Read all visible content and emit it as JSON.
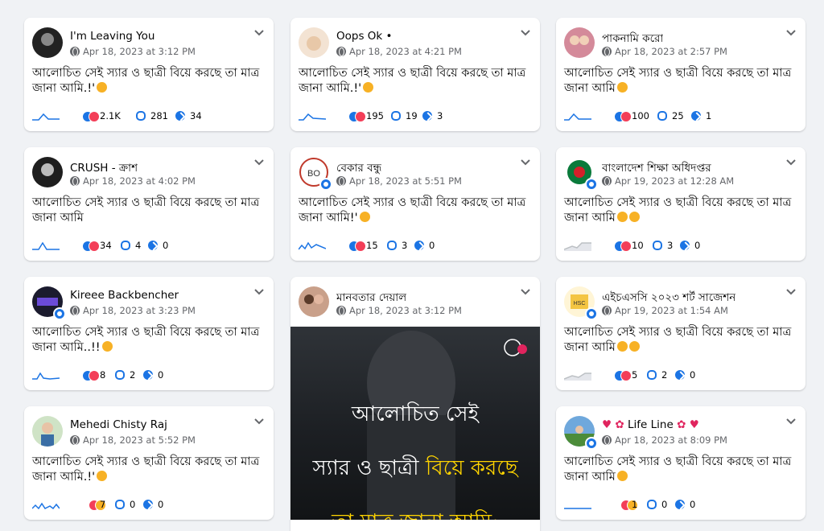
{
  "colors": {
    "accent": "#1b74e4",
    "love": "#f33e58",
    "haha": "#f7b125",
    "page_bg": "#f0f2f5"
  },
  "icons": {
    "menu": "chevron-down-icon",
    "privacy": "globe-icon",
    "comments": "comment-icon",
    "shares": "share-icon",
    "trend": "sparkline-icon"
  },
  "cards": [
    {
      "name": "I'm Leaving You",
      "date": "Apr 18, 2023 at 3:12 PM",
      "text": "আলোচিত সেই স্যার ও ছাত্রী বিয়ে করছে তা মাত্র জানা আমি.!'",
      "reactions": "2.1K",
      "comments": "281",
      "shares": "34"
    },
    {
      "name": "Oops Ok •",
      "date": "Apr 18, 2023 at 4:21 PM",
      "text": "আলোচিত সেই স্যার ও ছাত্রী বিয়ে করছে তা মাত্র জানা আমি.!'",
      "reactions": "195",
      "comments": "19",
      "shares": "3"
    },
    {
      "name": "পাকনামি করো",
      "date": "Apr 18, 2023 at 2:57 PM",
      "text": "আলোচিত সেই স্যার ও ছাত্রী বিয়ে করছে তা মাত্র জানা আমি",
      "reactions": "100",
      "comments": "25",
      "shares": "1"
    },
    {
      "name": "CRUSH - ক্রাশ",
      "date": "Apr 18, 2023 at 4:02 PM",
      "text": "আলোচিত সেই স্যার ও ছাত্রী বিয়ে করছে তা মাত্র জানা আমি",
      "reactions": "34",
      "comments": "4",
      "shares": "0"
    },
    {
      "name": "বেকার বন্ধু",
      "date": "Apr 18, 2023 at 5:51 PM",
      "text": "আলোচিত সেই স্যার ও ছাত্রী বিয়ে করছে তা মাত্র জানা আমি!'",
      "reactions": "15",
      "comments": "3",
      "shares": "0"
    },
    {
      "name": "বাংলাদেশ শিক্ষা অধিদপ্তর",
      "date": "Apr 19, 2023 at 12:28 AM",
      "text": "আলোচিত সেই স্যার ও ছাত্রী বিয়ে করছে তা মাত্র জানা আমি",
      "reactions": "10",
      "comments": "3",
      "shares": "0"
    },
    {
      "name": "Kireee Backbencher",
      "date": "Apr 18, 2023 at 3:23 PM",
      "text": "আলোচিত সেই স্যার ও ছাত্রী বিয়ে করছে তা মাত্র জানা আমি..!!",
      "reactions": "8",
      "comments": "2",
      "shares": "0"
    },
    {
      "name": "মানবতার দেয়াল",
      "date": "Apr 18, 2023 at 3:12 PM",
      "image_line1": "আলোচিত সেই",
      "image_line2a": "স্যার ও ছাত্রী ",
      "image_line2b": "বিয়ে করছে",
      "image_line3": "তা মাত্র জানা আমি:"
    },
    {
      "name": "এইচএসসি ২০২৩ শর্ট সাজেশন",
      "date": "Apr 19, 2023 at 1:54 AM",
      "text": "আলোচিত সেই স্যার ও ছাত্রী বিয়ে করছে তা মাত্র জানা আমি",
      "reactions": "5",
      "comments": "2",
      "shares": "0"
    },
    {
      "name": "Mehedi Chisty Raj",
      "date": "Apr 18, 2023 at 5:52 PM",
      "text": "আলোচিত সেই স্যার ও ছাত্রী বিয়ে করছে তা মাত্র জানা আমি.!'",
      "reactions": "7",
      "comments": "0",
      "shares": "0"
    },
    {
      "name": "Life Line",
      "date": "Apr 18, 2023 at 8:09 PM",
      "text": "আলোচিত সেই স্যার ও ছাত্রী বিয়ে করছে তা মাত্র জানা আমি",
      "reactions": "1",
      "comments": "0",
      "shares": "0"
    }
  ]
}
